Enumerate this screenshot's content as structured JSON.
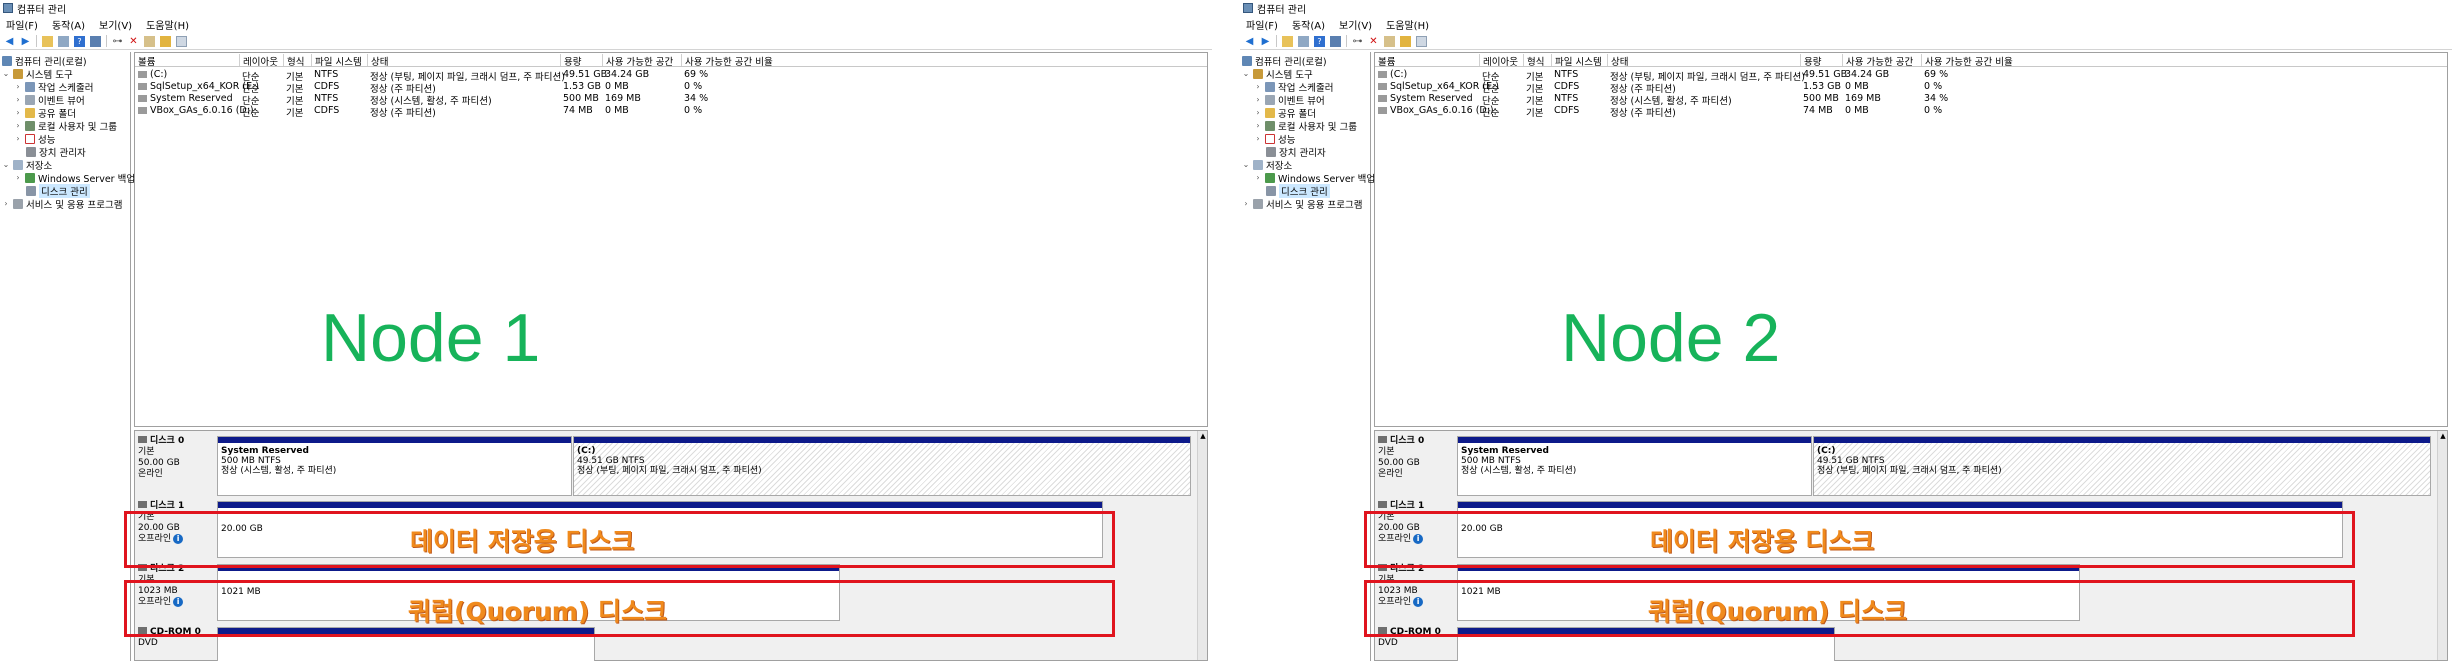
{
  "nodes": [
    {
      "window_title": "컴퓨터 관리",
      "menu": [
        "파일(F)",
        "동작(A)",
        "보기(V)",
        "도움말(H)"
      ],
      "tree": {
        "root": "컴퓨터 관리(로컬)",
        "system_tools": "시스템 도구",
        "task_scheduler": "작업 스케줄러",
        "event_viewer": "이벤트 뷰어",
        "shared_folders": "공유 폴더",
        "local_users": "로컬 사용자 및 그룹",
        "performance": "성능",
        "device_manager": "장치 관리자",
        "storage": "저장소",
        "windows_backup": "Windows Server 백업",
        "disk_management": "디스크 관리",
        "services_apps": "서비스 및 응용 프로그램"
      },
      "volume_columns": [
        "볼륨",
        "레이아웃",
        "형식",
        "파일 시스템",
        "상태",
        "용량",
        "사용 가능한 공간",
        "사용 가능한 공간 비율"
      ],
      "volumes": [
        {
          "name": "(C:)",
          "layout": "단순",
          "type": "기본",
          "fs": "NTFS",
          "status": "정상 (부팅, 페이지 파일, 크래시 덤프, 주 파티션)",
          "capacity": "49.51 GB",
          "free": "34.24 GB",
          "pct": "69 %"
        },
        {
          "name": "SqlSetup_x64_KOR (E:)",
          "layout": "단순",
          "type": "기본",
          "fs": "CDFS",
          "status": "정상 (주 파티션)",
          "capacity": "1.53 GB",
          "free": "0 MB",
          "pct": "0 %"
        },
        {
          "name": "System Reserved",
          "layout": "단순",
          "type": "기본",
          "fs": "NTFS",
          "status": "정상 (시스템, 활성, 주 파티션)",
          "capacity": "500 MB",
          "free": "169 MB",
          "pct": "34 %"
        },
        {
          "name": "VBox_GAs_6.0.16 (D:)",
          "layout": "단순",
          "type": "기본",
          "fs": "CDFS",
          "status": "정상 (주 파티션)",
          "capacity": "74 MB",
          "free": "0 MB",
          "pct": "0 %"
        }
      ],
      "node_label": "Node 1",
      "disks": {
        "disk0": {
          "name": "디스크 0",
          "type": "기본",
          "size": "50.00 GB",
          "state": "온라인",
          "p1_title": "System Reserved",
          "p1_size": "500 MB NTFS",
          "p1_status": "정상 (시스템, 활성, 주 파티션)",
          "p2_title": "(C:)",
          "p2_size": "49.51 GB NTFS",
          "p2_status": "정상 (부팅, 페이지 파일, 크래시 덤프, 주 파티션)"
        },
        "disk1": {
          "name": "디스크 1",
          "type": "기본",
          "size": "20.00 GB",
          "state": "오프라인",
          "p_size": "20.00 GB"
        },
        "disk2": {
          "name": "디스크 2",
          "type": "기본",
          "size": "1023 MB",
          "state": "오프라인",
          "p_size": "1021 MB"
        },
        "cdrom": {
          "name": "CD-ROM 0",
          "type": "DVD"
        }
      },
      "overlay_data": "데이터 저장용 디스크",
      "overlay_quorum": "쿼럼(Quorum) 디스크"
    },
    {
      "window_title": "컴퓨터 관리",
      "menu": [
        "파일(F)",
        "동작(A)",
        "보기(V)",
        "도움말(H)"
      ],
      "tree": {
        "root": "컴퓨터 관리(로컬)",
        "system_tools": "시스템 도구",
        "task_scheduler": "작업 스케줄러",
        "event_viewer": "이벤트 뷰어",
        "shared_folders": "공유 폴더",
        "local_users": "로컬 사용자 및 그룹",
        "performance": "성능",
        "device_manager": "장치 관리자",
        "storage": "저장소",
        "windows_backup": "Windows Server 백업",
        "disk_management": "디스크 관리",
        "services_apps": "서비스 및 응용 프로그램"
      },
      "volume_columns": [
        "볼륨",
        "레이아웃",
        "형식",
        "파일 시스템",
        "상태",
        "용량",
        "사용 가능한 공간",
        "사용 가능한 공간 비율"
      ],
      "volumes": [
        {
          "name": "(C:)",
          "layout": "단순",
          "type": "기본",
          "fs": "NTFS",
          "status": "정상 (부팅, 페이지 파일, 크래시 덤프, 주 파티션)",
          "capacity": "49.51 GB",
          "free": "34.24 GB",
          "pct": "69 %"
        },
        {
          "name": "SqlSetup_x64_KOR (E:)",
          "layout": "단순",
          "type": "기본",
          "fs": "CDFS",
          "status": "정상 (주 파티션)",
          "capacity": "1.53 GB",
          "free": "0 MB",
          "pct": "0 %"
        },
        {
          "name": "System Reserved",
          "layout": "단순",
          "type": "기본",
          "fs": "NTFS",
          "status": "정상 (시스템, 활성, 주 파티션)",
          "capacity": "500 MB",
          "free": "169 MB",
          "pct": "34 %"
        },
        {
          "name": "VBox_GAs_6.0.16 (D:)",
          "layout": "단순",
          "type": "기본",
          "fs": "CDFS",
          "status": "정상 (주 파티션)",
          "capacity": "74 MB",
          "free": "0 MB",
          "pct": "0 %"
        }
      ],
      "node_label": "Node 2",
      "disks": {
        "disk0": {
          "name": "디스크 0",
          "type": "기본",
          "size": "50.00 GB",
          "state": "온라인",
          "p1_title": "System Reserved",
          "p1_size": "500 MB NTFS",
          "p1_status": "정상 (시스템, 활성, 주 파티션)",
          "p2_title": "(C:)",
          "p2_size": "49.51 GB NTFS",
          "p2_status": "정상 (부팅, 페이지 파일, 크래시 덤프, 주 파티션)"
        },
        "disk1": {
          "name": "디스크 1",
          "type": "기본",
          "size": "20.00 GB",
          "state": "오프라인",
          "p_size": "20.00 GB"
        },
        "disk2": {
          "name": "디스크 2",
          "type": "기본",
          "size": "1023 MB",
          "state": "오프라인",
          "p_size": "1021 MB"
        },
        "cdrom": {
          "name": "CD-ROM 0",
          "type": "DVD"
        }
      },
      "overlay_data": "데이터 저장용 디스크",
      "overlay_quorum": "쿼럼(Quorum) 디스크"
    }
  ]
}
